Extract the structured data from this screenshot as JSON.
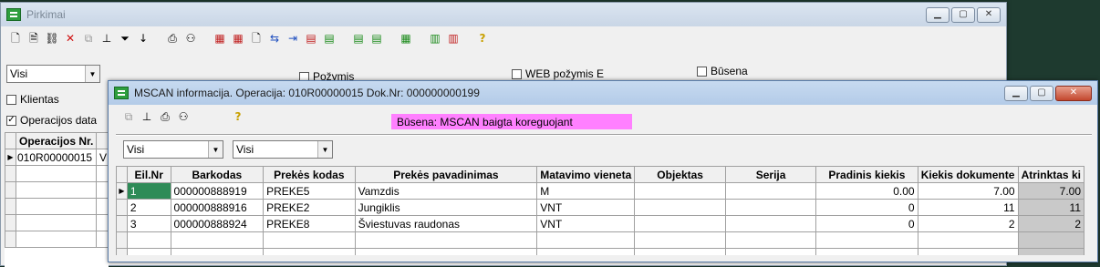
{
  "main_window": {
    "title": "Pirkimai",
    "filter_select": "Visi",
    "checkboxes": {
      "pozymis": {
        "label": "Požymis",
        "checked": false
      },
      "web_pozymis": {
        "label": "WEB požymis E",
        "checked": false
      },
      "busena": {
        "label": "Būsena",
        "checked": false
      },
      "klientas": {
        "label": "Klientas",
        "checked": false
      },
      "operacijos_data": {
        "label": "Operacijos data",
        "checked": true
      }
    },
    "grid": {
      "header": "Operacijos Nr.",
      "rows": [
        {
          "op_nr": "010R00000015",
          "extra": "V"
        }
      ]
    }
  },
  "dialog": {
    "title": "MSCAN informacija. Operacija: 010R00000015 Dok.Nr: 000000000199",
    "status": "Būsena: MSCAN baigta koreguojant",
    "filter1": "Visi",
    "filter2": "Visi",
    "columns": [
      "Eil.Nr",
      "Barkodas",
      "Prekės kodas",
      "Prekės pavadinimas",
      "Matavimo vieneta",
      "Objektas",
      "Serija",
      "Pradinis kiekis",
      "Kiekis dokumente",
      "Atrinktas ki"
    ],
    "rows": [
      {
        "eil": "1",
        "barkodas": "000000888919",
        "kodas": "PREKE5",
        "pavadinimas": "Vamzdis",
        "vnt": "M",
        "objektas": "",
        "serija": "",
        "pradinis": "0.00",
        "dokumente": "7.00",
        "atrinktas": "7.00"
      },
      {
        "eil": "2",
        "barkodas": "000000888916",
        "kodas": "PREKE2",
        "pavadinimas": "Jungiklis",
        "vnt": "VNT",
        "objektas": "",
        "serija": "",
        "pradinis": "0",
        "dokumente": "11",
        "atrinktas": "11"
      },
      {
        "eil": "3",
        "barkodas": "000000888924",
        "kodas": "PREKE8",
        "pavadinimas": "Šviestuvas raudonas",
        "vnt": "VNT",
        "objektas": "",
        "serija": "",
        "pradinis": "0",
        "dokumente": "2",
        "atrinktas": "2"
      }
    ]
  },
  "colors": {
    "status_bg": "#ff80ff",
    "selected_cell": "#2e8b57",
    "readonly_col": "#c9c9c9"
  }
}
